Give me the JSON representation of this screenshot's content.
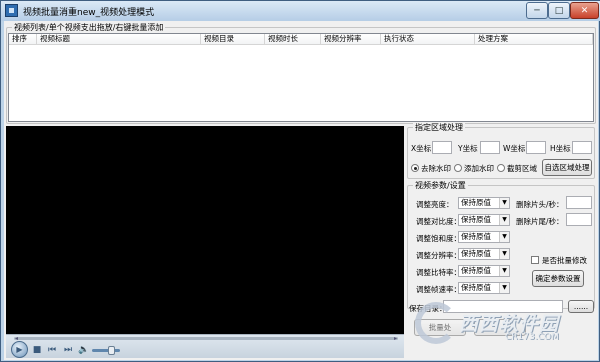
{
  "window": {
    "title": "视频批量消重new_视频处理模式",
    "min_glyph": "─",
    "max_glyph": "□",
    "close_glyph": "✕"
  },
  "list": {
    "group_title": "视频列表/单个视频支出拖放/右键批量添加",
    "columns": [
      "排序",
      "视频标题",
      "视频目录",
      "视频时长",
      "视频分辨率",
      "执行状态",
      "处理方案"
    ]
  },
  "region": {
    "group_title": "指定区域处理",
    "x_label": "X坐标",
    "y_label": "Y坐标",
    "w_label": "W坐标",
    "h_label": "H坐标",
    "x_value": "",
    "y_value": "",
    "w_value": "",
    "h_value": "",
    "radio_remove": "去除水印",
    "radio_add": "添加水印",
    "radio_crop": "截剪区域",
    "selected_radio": "去除水印",
    "custom_button": "自选区域处理"
  },
  "params": {
    "group_title": "视频参数/设置",
    "rows": [
      {
        "label": "调整亮度：",
        "value": "保持原值"
      },
      {
        "label": "调整对比度：",
        "value": "保持原值"
      },
      {
        "label": "调整饱和度：",
        "value": "保持原值"
      },
      {
        "label": "调整分辨率：",
        "value": "保持原值"
      },
      {
        "label": "调整比特率：",
        "value": "保持原值"
      },
      {
        "label": "调整帧速率：",
        "value": "保持原值"
      }
    ],
    "cut_head_label": "删除片头/秒：",
    "cut_head_value": "",
    "cut_tail_label": "删除片尾/秒：",
    "cut_tail_value": "",
    "batch_checkbox_label": "是否批量修改",
    "batch_checked": false,
    "confirm_button": "确定参数设置"
  },
  "save": {
    "label": "保存目录：",
    "value": "",
    "browse_button": "......",
    "bottom_button_partial": "批量处"
  },
  "player": {
    "play_glyph": "▶",
    "stop_glyph": "■",
    "prev_glyph": "⏮",
    "next_glyph": "⏭",
    "mute_glyph": "🔈"
  },
  "watermark": {
    "text": "西西软件园",
    "site": "CR173.COM"
  }
}
